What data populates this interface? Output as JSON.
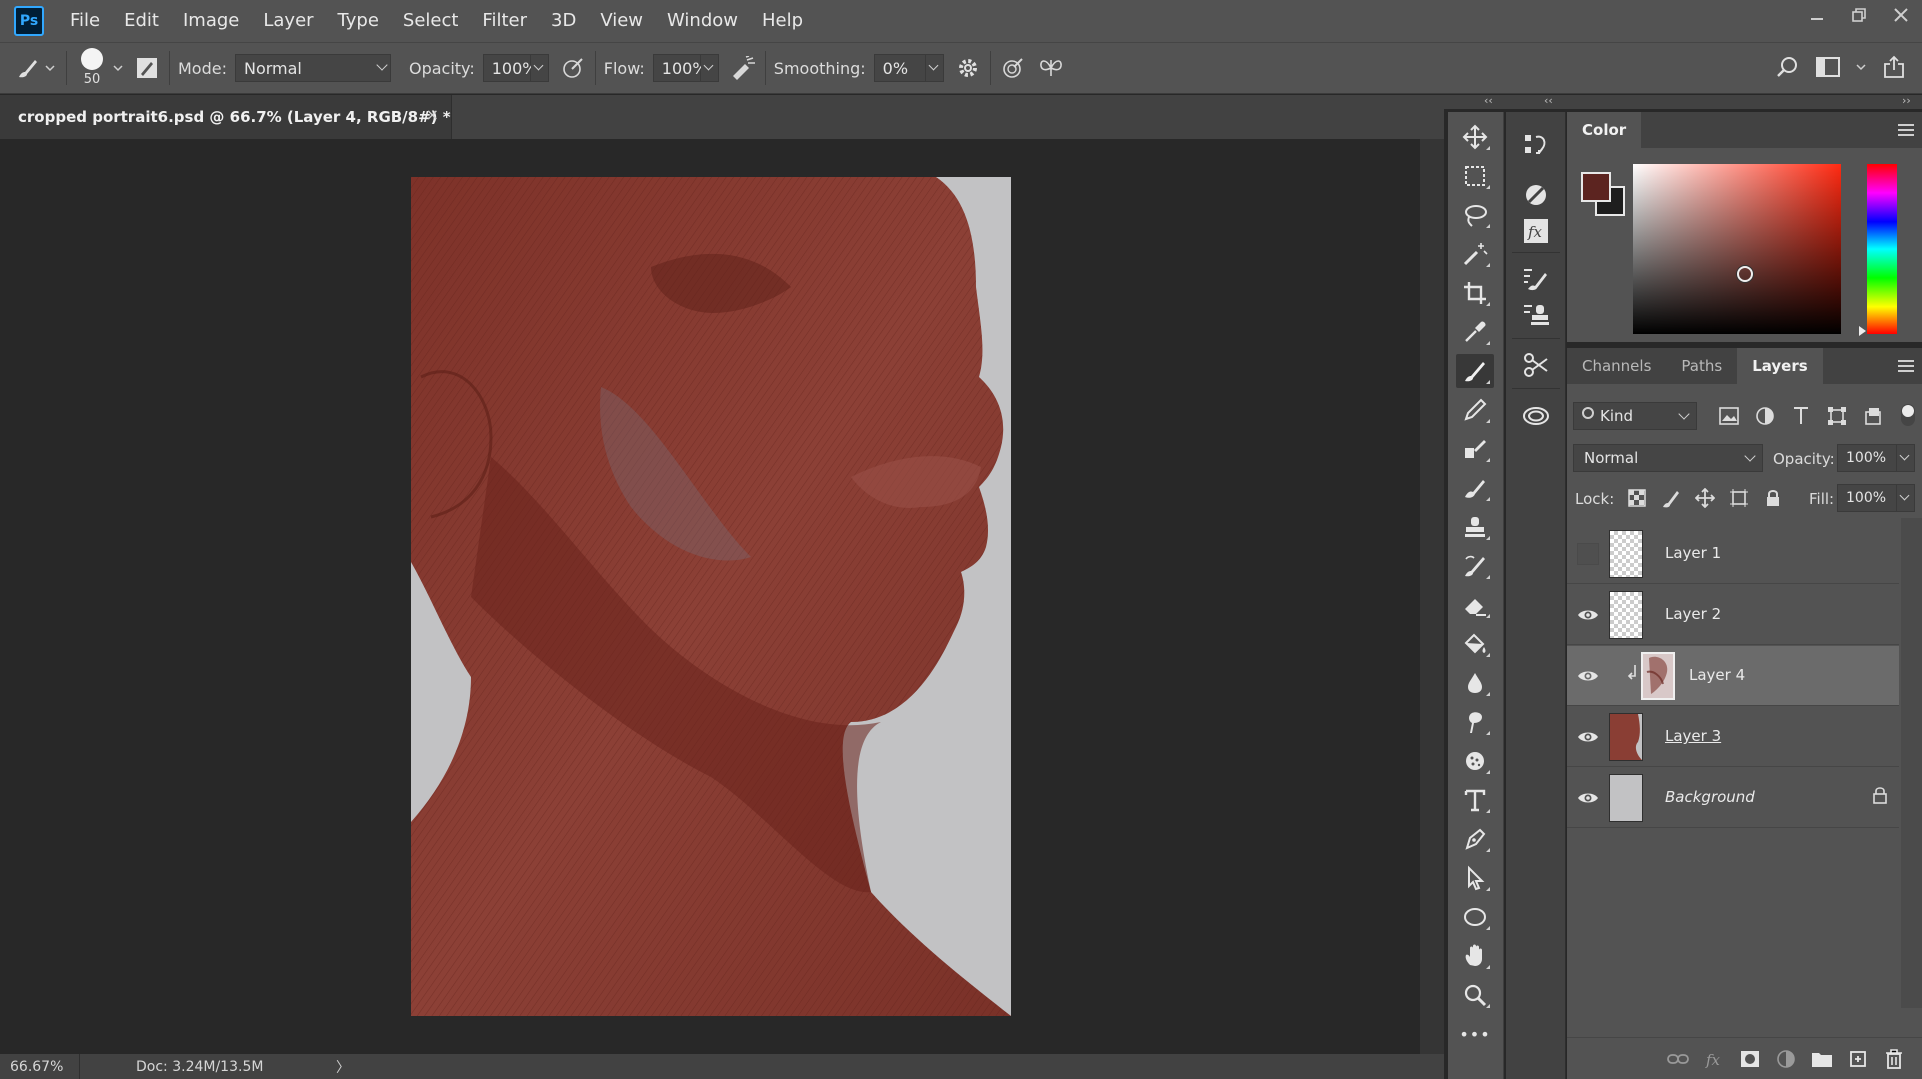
{
  "app": {
    "logo": "Ps"
  },
  "menu": [
    "File",
    "Edit",
    "Image",
    "Layer",
    "Type",
    "Select",
    "Filter",
    "3D",
    "View",
    "Window",
    "Help"
  ],
  "window_controls": [
    "minimize-icon",
    "restore-icon",
    "close-icon"
  ],
  "options_bar": {
    "brush_size": "50",
    "mode_label": "Mode:",
    "mode_value": "Normal",
    "opacity_label": "Opacity:",
    "opacity_value": "100%",
    "flow_label": "Flow:",
    "flow_value": "100%",
    "smoothing_label": "Smoothing:",
    "smoothing_value": "0%"
  },
  "document": {
    "tab_title": "cropped portrait6.psd @ 66.7% (Layer 4, RGB/8#) *",
    "close_symbol": "×",
    "zoom": "66.67%",
    "doc_info": "Doc: 3.24M/13.5M",
    "status_arrow": "〉"
  },
  "tools": [
    "move-tool",
    "marquee-tool",
    "lasso-tool",
    "magic-wand-tool",
    "crop-tool",
    "eyedropper-tool",
    "brush-tool",
    "pencil-tool",
    "clone-stamp-tool",
    "mixer-brush-tool",
    "stamp-tool",
    "history-brush-tool",
    "eraser-tool",
    "paint-bucket-tool",
    "blur-tool",
    "smudge-tool",
    "sponge-tool",
    "type-tool",
    "pen-tool",
    "path-selection-tool",
    "ellipse-tool",
    "hand-tool",
    "zoom-tool",
    "more-tools"
  ],
  "tools_more_label": "•••",
  "color_panel": {
    "title": "Color",
    "foreground": "#5c2420",
    "background": "#1e1e1e"
  },
  "layers_panel": {
    "tabs": [
      "Channels",
      "Paths",
      "Layers"
    ],
    "active_tab": "Layers",
    "kind_label": "Kind",
    "blend_mode": "Normal",
    "opacity_label": "Opacity:",
    "opacity_value": "100%",
    "lock_label": "Lock:",
    "fill_label": "Fill:",
    "fill_value": "100%",
    "layers": [
      {
        "name": "Layer 1",
        "visible": false
      },
      {
        "name": "Layer 2",
        "visible": true
      },
      {
        "name": "Layer 4",
        "visible": true,
        "selected": true,
        "clipped": true
      },
      {
        "name": "Layer 3",
        "visible": true
      },
      {
        "name": "Background",
        "visible": true,
        "locked": true
      }
    ]
  },
  "colors": {
    "ui_dark": "#282828",
    "ui_panel": "#535353",
    "skin": "#8a3e34",
    "background_gray": "#c2c2c4"
  }
}
